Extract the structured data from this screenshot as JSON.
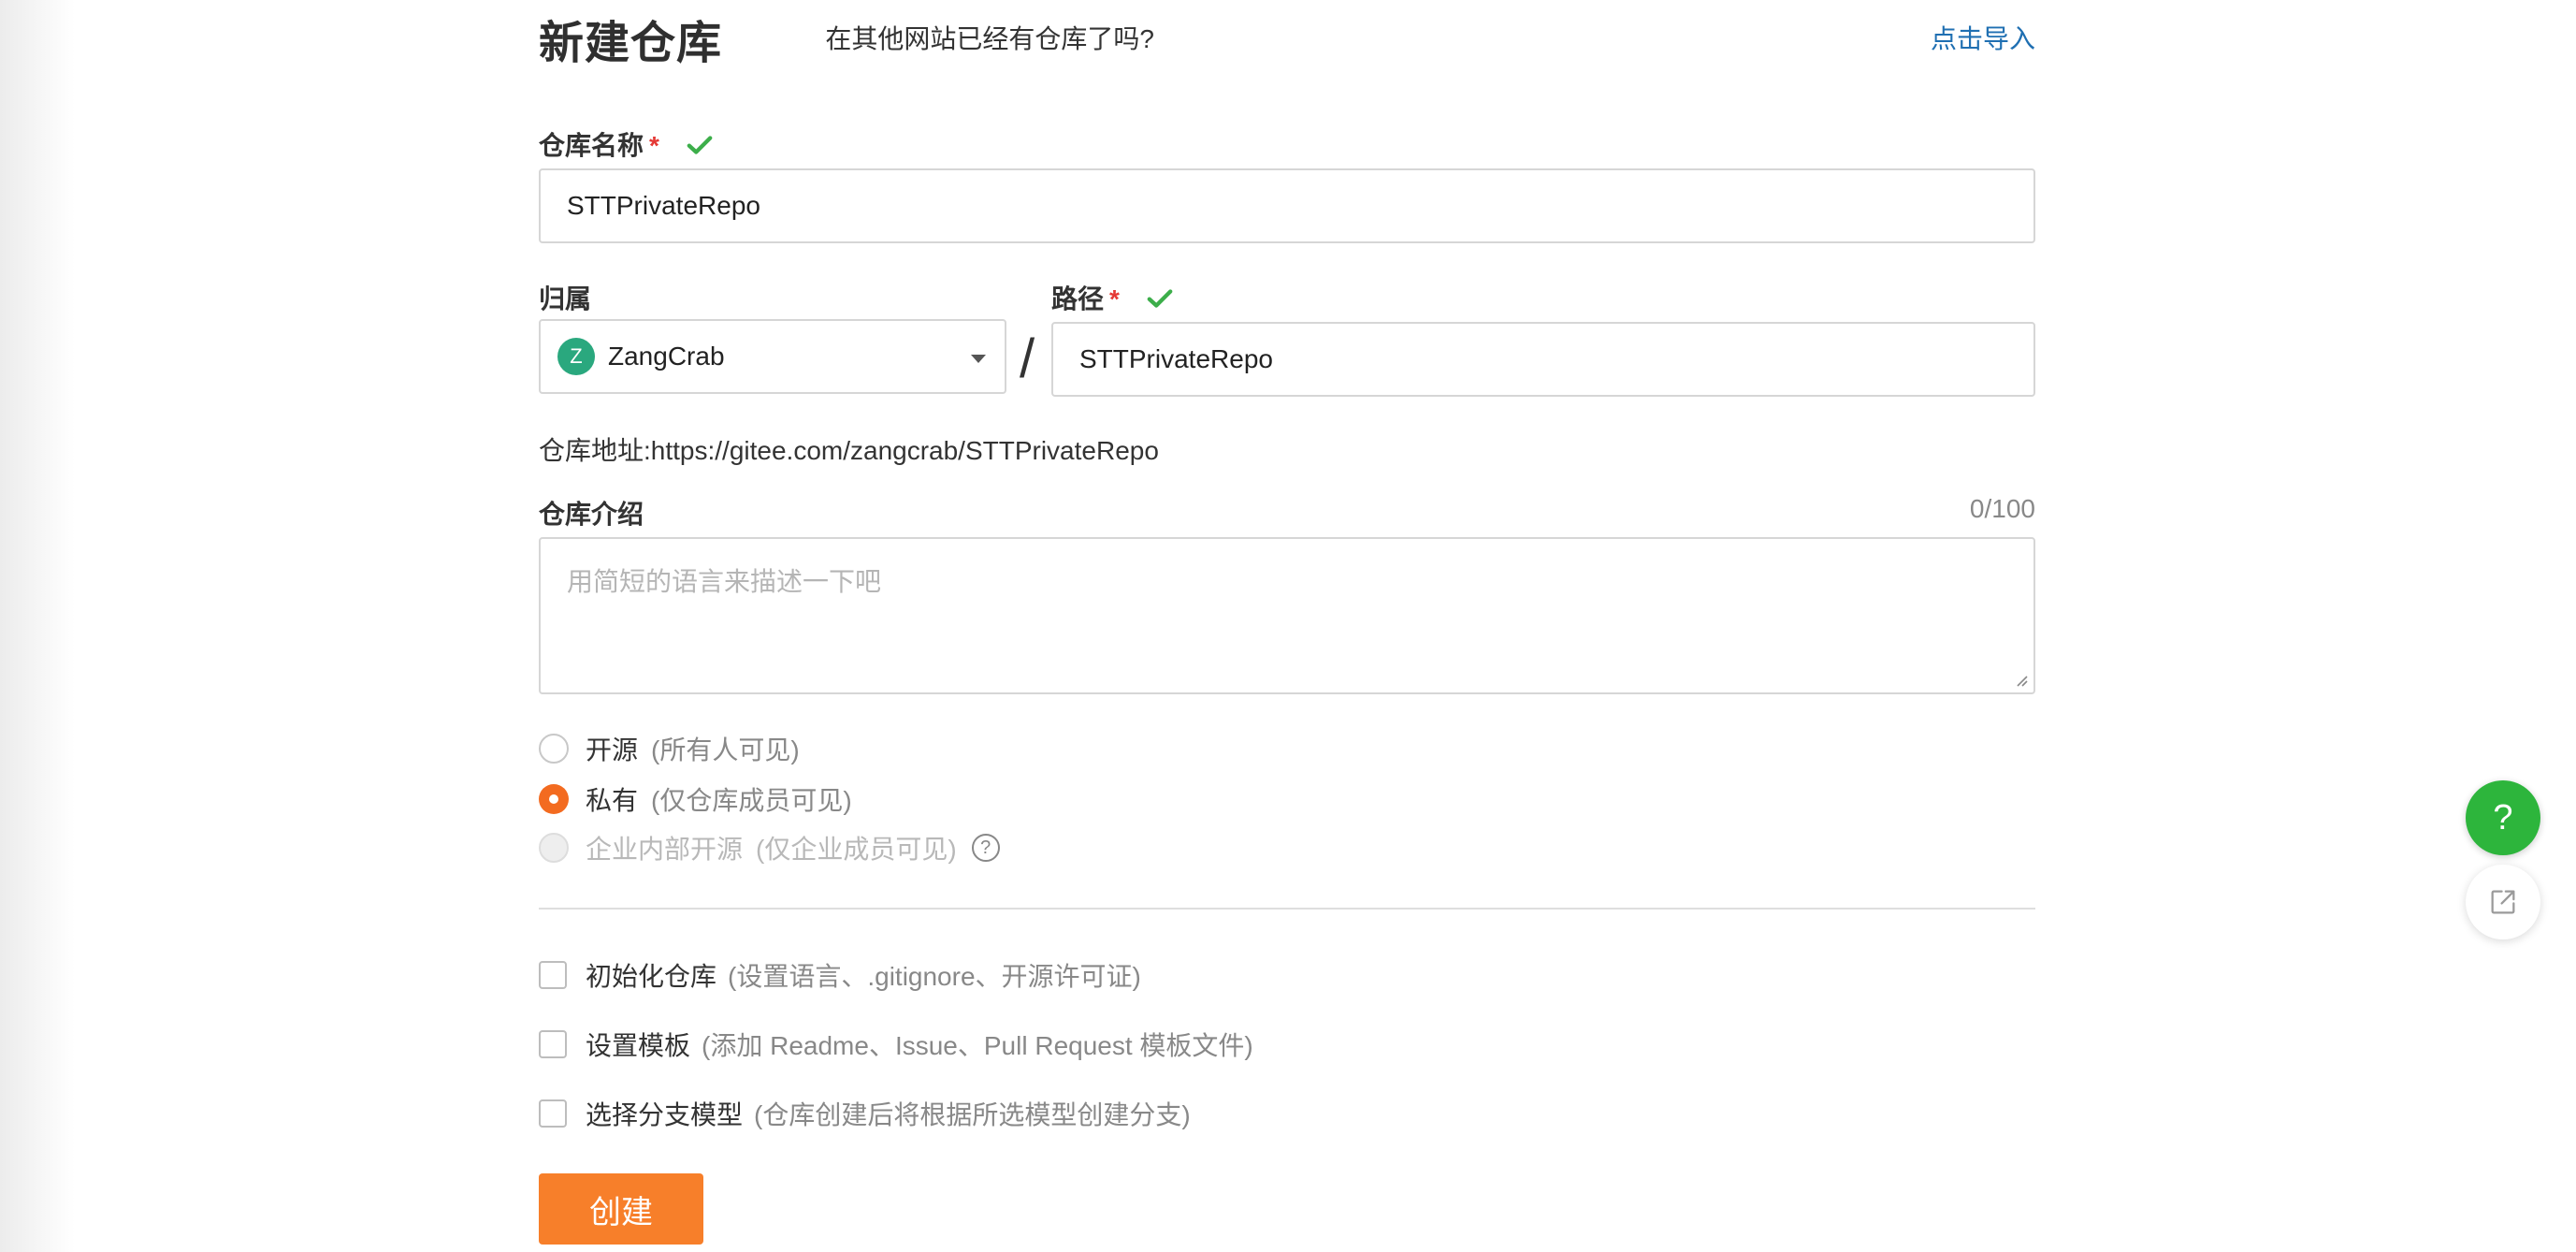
{
  "header": {
    "title": "新建仓库",
    "import_question": "在其他网站已经有仓库了吗?",
    "import_link": "点击导入"
  },
  "repo_name": {
    "label": "仓库名称",
    "required_mark": "*",
    "value": "STTPrivateRepo"
  },
  "owner": {
    "label": "归属",
    "avatar_letter": "Z",
    "selected": "ZangCrab"
  },
  "separator": "/",
  "path": {
    "label": "路径",
    "required_mark": "*",
    "value": "STTPrivateRepo"
  },
  "address": {
    "text": "仓库地址:https://gitee.com/zangcrab/STTPrivateRepo"
  },
  "description": {
    "label": "仓库介绍",
    "counter": "0/100",
    "placeholder": "用简短的语言来描述一下吧"
  },
  "visibility": [
    {
      "label": "开源",
      "hint": "(所有人可见)",
      "state": "unselected"
    },
    {
      "label": "私有",
      "hint": "(仅仓库成员可见)",
      "state": "selected"
    },
    {
      "label": "企业内部开源",
      "hint": "(仅企业成员可见)",
      "state": "disabled",
      "help": "?"
    }
  ],
  "options": [
    {
      "label": "初始化仓库",
      "hint": "(设置语言、.gitignore、开源许可证)",
      "checked": false
    },
    {
      "label": "设置模板",
      "hint": "(添加 Readme、Issue、Pull Request 模板文件)",
      "checked": false
    },
    {
      "label": "选择分支模型",
      "hint": "(仓库创建后将根据所选模型创建分支)",
      "checked": false
    }
  ],
  "create_button": "创建",
  "floating": {
    "help_label": "?",
    "share_icon": "share-icon"
  },
  "colors": {
    "accent_orange": "#f77f2a",
    "radio_selected": "#f36b20",
    "link_blue": "#1f6fb2",
    "success_green": "#3cae4a",
    "help_fab_green": "#2db53c",
    "required_red": "#e53935"
  }
}
